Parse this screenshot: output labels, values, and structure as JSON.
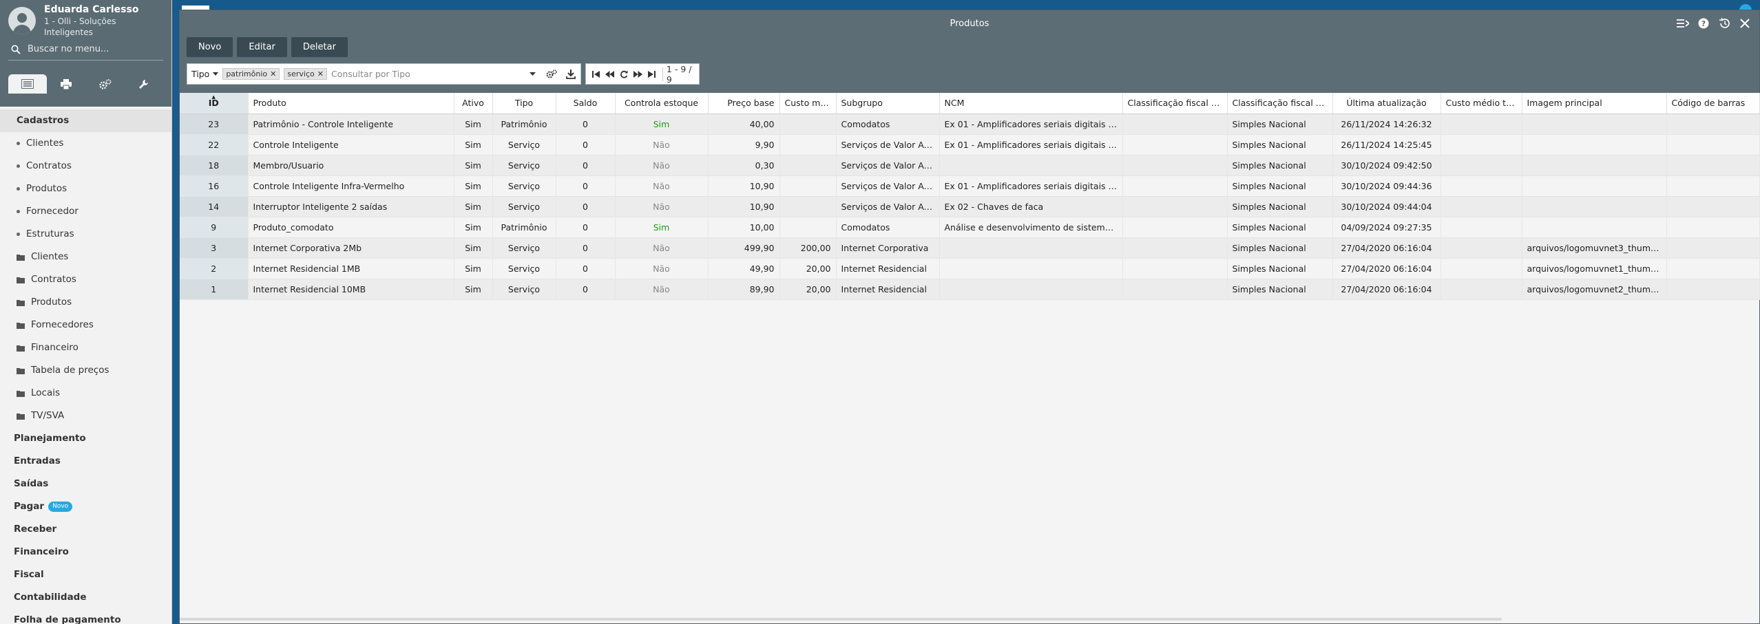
{
  "user": {
    "name": "Eduarda Carlesso",
    "company": "1 - Olli - Soluções Inteligentes"
  },
  "search": {
    "placeholder": "Buscar no menu..."
  },
  "menu": {
    "cadastros": "Cadastros",
    "bullets": [
      "Clientes",
      "Contratos",
      "Produtos",
      "Fornecedor",
      "Estruturas"
    ],
    "folders": [
      "Clientes",
      "Contratos",
      "Produtos",
      "Fornecedores",
      "Financeiro",
      "Tabela de preços",
      "Locais",
      "TV/SVA"
    ],
    "sections": [
      "Planejamento",
      "Entradas",
      "Saídas",
      "Pagar",
      "Receber",
      "Financeiro",
      "Fiscal",
      "Contabilidade",
      "Folha de pagamento"
    ],
    "new_badge": "Novo"
  },
  "window": {
    "title": "Produtos",
    "buttons": {
      "new": "Novo",
      "edit": "Editar",
      "delete": "Deletar"
    },
    "filter": {
      "field": "Tipo",
      "chips": [
        "patrimônio",
        "serviço"
      ],
      "placeholder": "Consultar por Tipo"
    },
    "pagination": "1 - 9 / 9"
  },
  "columns": [
    "ID",
    "Produto",
    "Ativo",
    "Tipo",
    "Saldo",
    "Controla estoque",
    "Preço base",
    "Custo mé...",
    "Subgrupo",
    "NCM",
    "Classificação fiscal en...",
    "Classificação fiscal saí...",
    "Última atualização",
    "Custo médio to...",
    "Imagem principal",
    "Código de barras"
  ],
  "rows": [
    [
      "23",
      "Patrimônio - Controle Inteligente",
      "Sim",
      "Patrimônio",
      "0",
      "Sim",
      "40,00",
      "",
      "Comodatos",
      "Ex 01 - Amplificadores seriais digitais para ...",
      "",
      "Simples Nacional",
      "26/11/2024 14:26:32",
      "",
      "",
      ""
    ],
    [
      "22",
      "Controle Inteligente",
      "Sim",
      "Serviço",
      "0",
      "Não",
      "9,90",
      "",
      "Serviços de Valor Adic...",
      "Ex 01 - Amplificadores seriais digitais para ...",
      "",
      "Simples Nacional",
      "26/11/2024 14:25:45",
      "",
      "",
      ""
    ],
    [
      "18",
      "Membro/Usuario",
      "Sim",
      "Serviço",
      "0",
      "Não",
      "0,30",
      "",
      "Serviços de Valor Adic...",
      "",
      "",
      "Simples Nacional",
      "30/10/2024 09:42:50",
      "",
      "",
      ""
    ],
    [
      "16",
      "Controle Inteligente Infra-Vermelho",
      "Sim",
      "Serviço",
      "0",
      "Não",
      "10,90",
      "",
      "Serviços de Valor Adic...",
      "Ex 01 - Amplificadores seriais digitais para ...",
      "",
      "Simples Nacional",
      "30/10/2024 09:44:36",
      "",
      "",
      ""
    ],
    [
      "14",
      "Interruptor Inteligente 2 saídas",
      "Sim",
      "Serviço",
      "0",
      "Não",
      "10,90",
      "",
      "Serviços de Valor Adic...",
      "Ex 02 - Chaves de faca",
      "",
      "Simples Nacional",
      "30/10/2024 09:44:04",
      "",
      "",
      ""
    ],
    [
      "9",
      "Produto_comodato",
      "Sim",
      "Patrimônio",
      "0",
      "Sim",
      "10,00",
      "",
      "Comodatos",
      "Análise e desenvolvimento de sistemas.",
      "",
      "Simples Nacional",
      "04/09/2024 09:27:35",
      "",
      "",
      ""
    ],
    [
      "3",
      "Internet Corporativa 2Mb",
      "Sim",
      "Serviço",
      "0",
      "Não",
      "499,90",
      "200,00",
      "Internet Corporativa",
      "",
      "",
      "Simples Nacional",
      "27/04/2020 06:16:04",
      "",
      "arquivos/logomuvnet3_thumb.p...",
      ""
    ],
    [
      "2",
      "Internet Residencial 1MB",
      "Sim",
      "Serviço",
      "0",
      "Não",
      "49,90",
      "20,00",
      "Internet Residencial",
      "",
      "",
      "Simples Nacional",
      "27/04/2020 06:16:04",
      "",
      "arquivos/logomuvnet1_thumb.p...",
      ""
    ],
    [
      "1",
      "Internet Residencial 10MB",
      "Sim",
      "Serviço",
      "0",
      "Não",
      "89,90",
      "20,00",
      "Internet Residencial",
      "",
      "",
      "Simples Nacional",
      "27/04/2020 06:16:04",
      "",
      "arquivos/logomuvnet2_thumb.p...",
      ""
    ]
  ],
  "colors": {
    "accent": "#2aa7e0",
    "header": "#5d6d75",
    "yes": "#1a9a1a",
    "no": "#888888"
  }
}
